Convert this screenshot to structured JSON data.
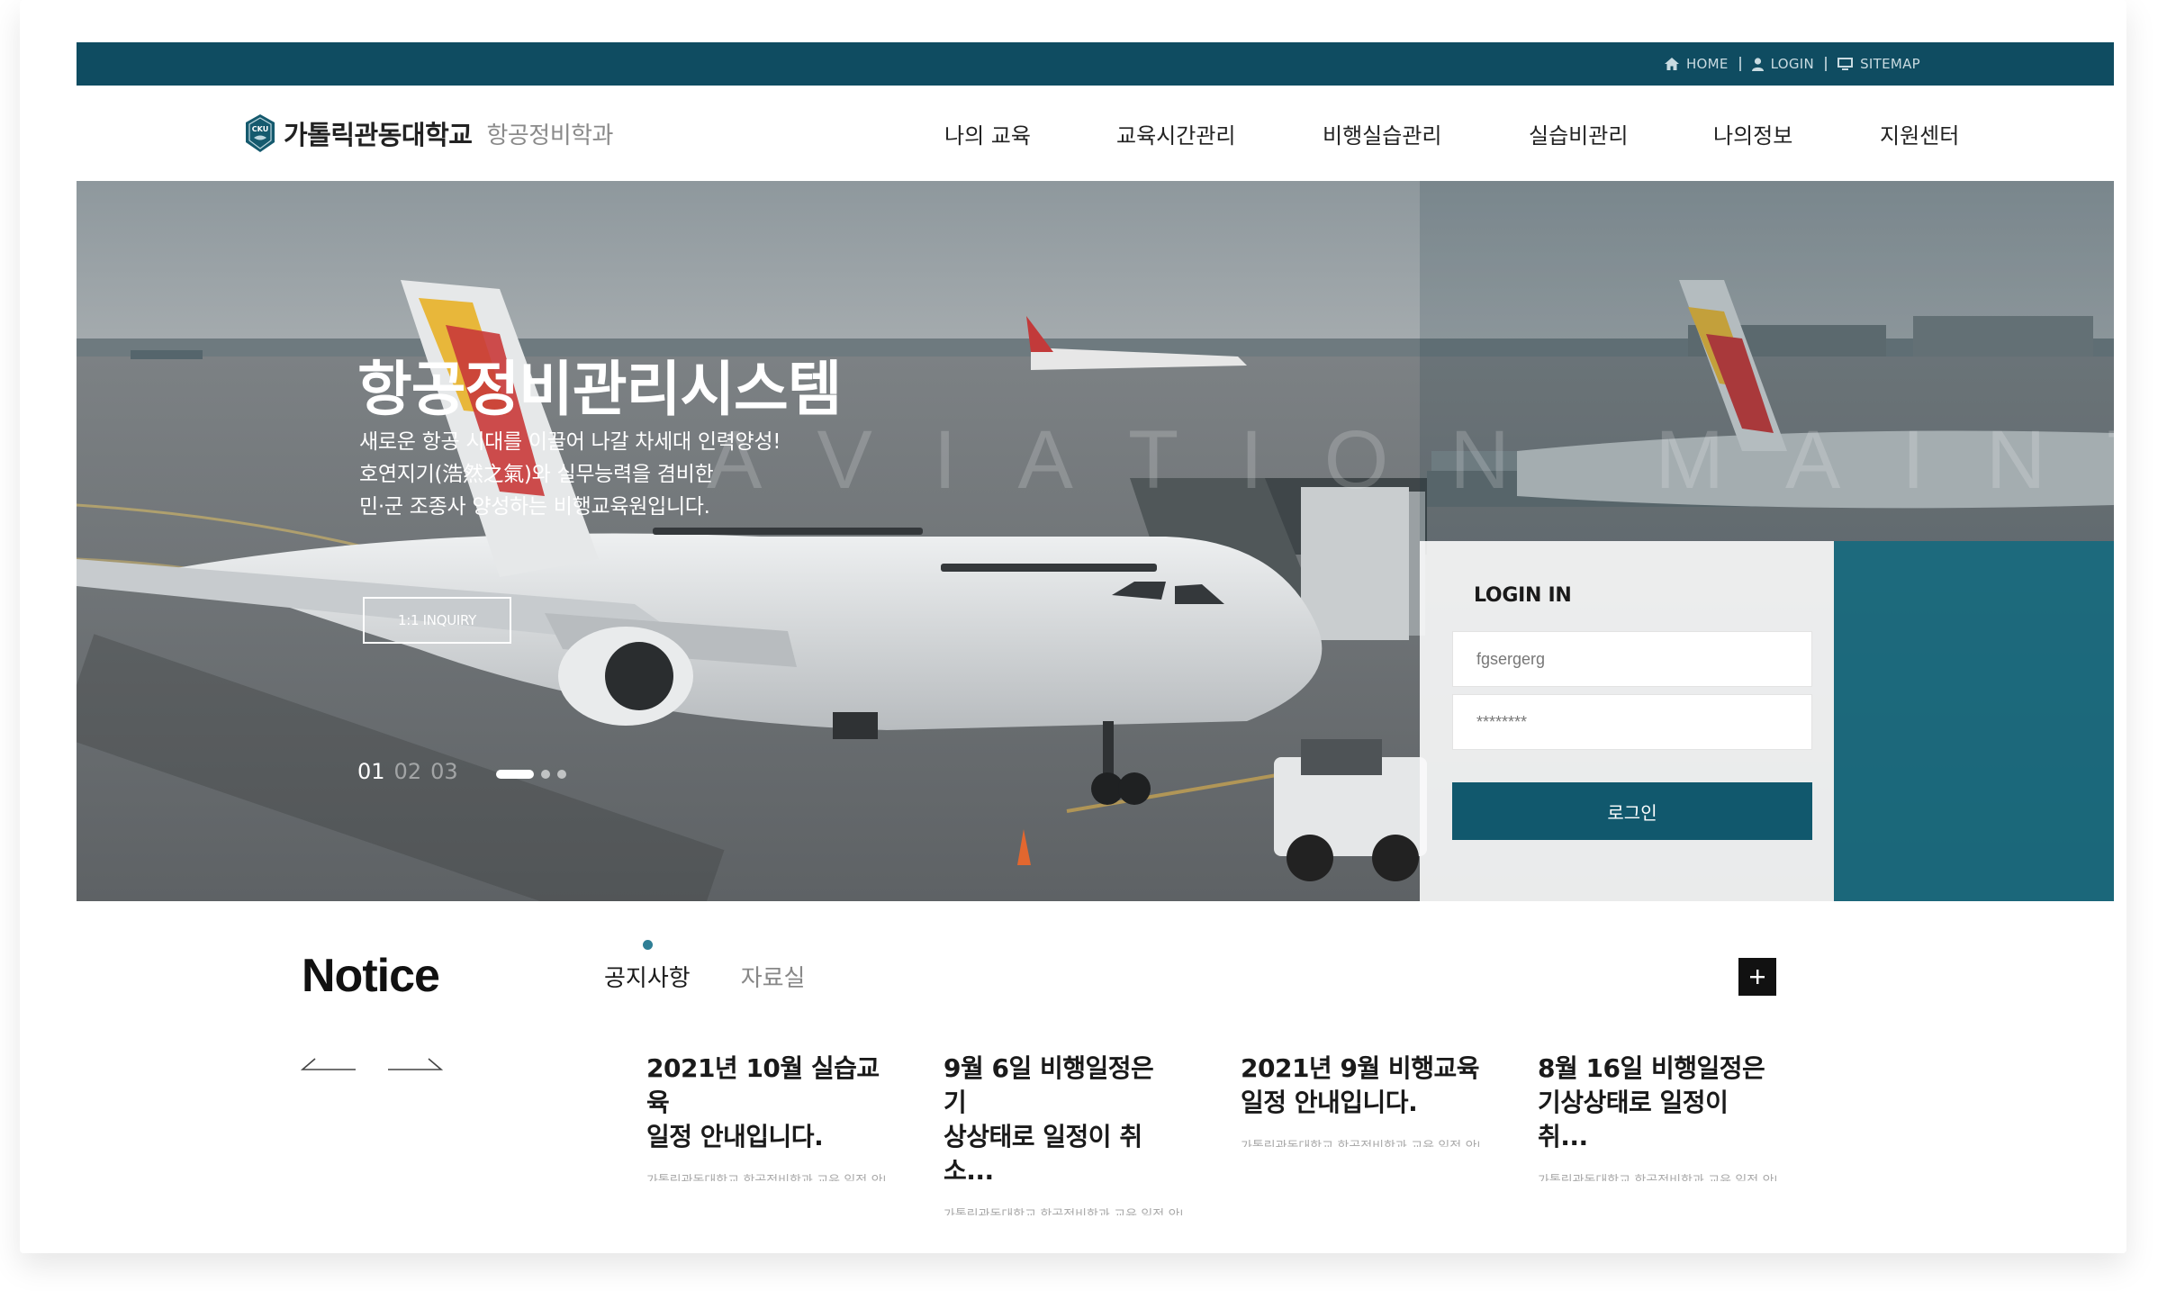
{
  "topnav": {
    "home": "HOME",
    "login": "LOGIN",
    "sitemap": "SITEMAP"
  },
  "header": {
    "logo_name": "가톨릭관동대학교",
    "logo_dept": "항공정비학과",
    "logo_badge": "CKU",
    "nav": [
      "나의 교육",
      "교육시간관리",
      "비행실습관리",
      "실습비관리",
      "나의정보",
      "지원센터"
    ]
  },
  "hero": {
    "title": "항공정비관리시스템",
    "desc_lines": [
      "새로운 항공 시대를 이끌어 나갈 차세대 인력양성!",
      "호연지기(浩然之氣)와 실무능력을 겸비한",
      "민·군 조종사 양성하는 비행교육원입니다."
    ],
    "watermark": "AVIATION MAINTENANCE",
    "inquiry_button": "1:1 INQUIRY",
    "pages": [
      "01",
      "02",
      "03"
    ],
    "active_page": 0
  },
  "login": {
    "title": "LOGIN IN",
    "id_value": "fgsergerg",
    "password_value": "********",
    "submit_label": "로그인"
  },
  "notice": {
    "title": "Notice",
    "tabs": [
      "공지사항",
      "자료실"
    ],
    "active_tab": 0,
    "items": [
      {
        "title_l1": "2021년 10월 실습교육",
        "title_l2": "일정 안내입니다.",
        "desc": "가톨릭관동대학교 항공정비학과 교육 일정 안내"
      },
      {
        "title_l1": "9월 6일 비행일정은 기",
        "title_l2": "상상태로 일정이 취소...",
        "desc": "가톨릭관동대학교 항공정비학과 교육 일정 안내"
      },
      {
        "title_l1": "2021년 9월 비행교육",
        "title_l2": "일정 안내입니다.",
        "desc": "가톨릭관동대학교 항공정비학과 교육 일정 안내"
      },
      {
        "title_l1": "8월 16일 비행일정은",
        "title_l2": "기상상태로 일정이 취...",
        "desc": "가톨릭관동대학교 항공정비학과 교육 일정 안내"
      }
    ]
  },
  "colors": {
    "topbar": "#0f4c61",
    "accent": "#11586d",
    "teal_panel": "#0f6a80",
    "tab_dot": "#2f7f96"
  }
}
